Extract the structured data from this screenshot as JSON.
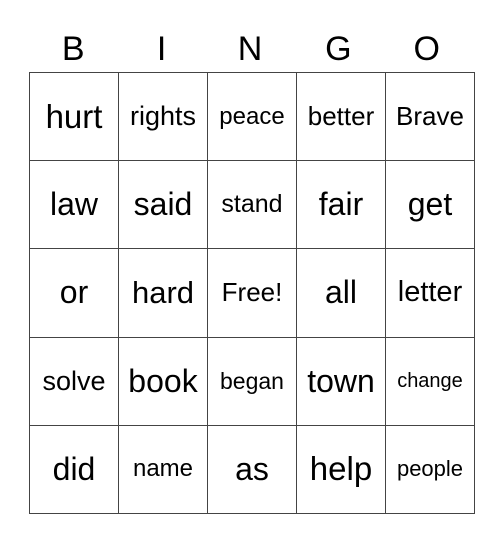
{
  "header": [
    "B",
    "I",
    "N",
    "G",
    "O"
  ],
  "rows": [
    [
      "hurt",
      "rights",
      "peace",
      "better",
      "Brave"
    ],
    [
      "law",
      "said",
      "stand",
      "fair",
      "get"
    ],
    [
      "or",
      "hard",
      "Free!",
      "all",
      "letter"
    ],
    [
      "solve",
      "book",
      "began",
      "town",
      "change"
    ],
    [
      "did",
      "name",
      "as",
      "help",
      "people"
    ]
  ]
}
